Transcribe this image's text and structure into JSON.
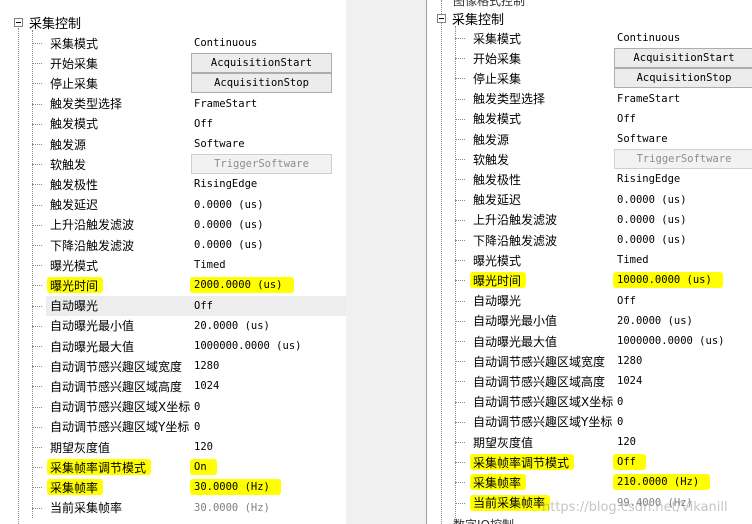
{
  "left": {
    "section_title": "采集控制",
    "rows": [
      {
        "name": "采集模式",
        "value": "Continuous",
        "kind": "text"
      },
      {
        "name": "开始采集",
        "value": "AcquisitionStart",
        "kind": "button"
      },
      {
        "name": "停止采集",
        "value": "AcquisitionStop",
        "kind": "button"
      },
      {
        "name": "触发类型选择",
        "value": "FrameStart",
        "kind": "text"
      },
      {
        "name": "触发模式",
        "value": "Off",
        "kind": "text"
      },
      {
        "name": "触发源",
        "value": "Software",
        "kind": "text"
      },
      {
        "name": "软触发",
        "value": "TriggerSoftware",
        "kind": "button-disabled"
      },
      {
        "name": "触发极性",
        "value": "RisingEdge",
        "kind": "text"
      },
      {
        "name": "触发延迟",
        "value": "0.0000 (us)",
        "kind": "text"
      },
      {
        "name": "上升沿触发滤波",
        "value": "0.0000 (us)",
        "kind": "text"
      },
      {
        "name": "下降沿触发滤波",
        "value": "0.0000 (us)",
        "kind": "text"
      },
      {
        "name": "曝光模式",
        "value": "Timed",
        "kind": "text"
      },
      {
        "name": "曝光时间",
        "value": "2000.0000 (us)",
        "kind": "text",
        "highlight_name": true,
        "highlight_value": true
      },
      {
        "name": "自动曝光",
        "value": "Off",
        "kind": "text",
        "selected": true
      },
      {
        "name": "自动曝光最小值",
        "value": "20.0000 (us)",
        "kind": "text"
      },
      {
        "name": "自动曝光最大值",
        "value": "1000000.0000 (us)",
        "kind": "text"
      },
      {
        "name": "自动调节感兴趣区域宽度",
        "value": "1280",
        "kind": "text"
      },
      {
        "name": "自动调节感兴趣区域高度",
        "value": "1024",
        "kind": "text"
      },
      {
        "name": "自动调节感兴趣区域X坐标",
        "value": "0",
        "kind": "text"
      },
      {
        "name": "自动调节感兴趣区域Y坐标",
        "value": "0",
        "kind": "text"
      },
      {
        "name": "期望灰度值",
        "value": "120",
        "kind": "text"
      },
      {
        "name": "采集帧率调节模式",
        "value": "On",
        "kind": "text",
        "highlight_name": true,
        "highlight_value": true
      },
      {
        "name": "采集帧率",
        "value": "30.0000 (Hz)",
        "kind": "text",
        "highlight_name": true,
        "highlight_value": true
      },
      {
        "name": "当前采集帧率",
        "value": "30.0000 (Hz)",
        "kind": "text",
        "disabled": true
      }
    ]
  },
  "right": {
    "top_fragment": "图像格式控制",
    "section_title": "采集控制",
    "bottom_fragment": "数字IO控制",
    "rows": [
      {
        "name": "采集模式",
        "value": "Continuous",
        "kind": "text"
      },
      {
        "name": "开始采集",
        "value": "AcquisitionStart",
        "kind": "button"
      },
      {
        "name": "停止采集",
        "value": "AcquisitionStop",
        "kind": "button"
      },
      {
        "name": "触发类型选择",
        "value": "FrameStart",
        "kind": "text"
      },
      {
        "name": "触发模式",
        "value": "Off",
        "kind": "text"
      },
      {
        "name": "触发源",
        "value": "Software",
        "kind": "text"
      },
      {
        "name": "软触发",
        "value": "TriggerSoftware",
        "kind": "button-disabled"
      },
      {
        "name": "触发极性",
        "value": "RisingEdge",
        "kind": "text"
      },
      {
        "name": "触发延迟",
        "value": "0.0000 (us)",
        "kind": "text"
      },
      {
        "name": "上升沿触发滤波",
        "value": "0.0000 (us)",
        "kind": "text"
      },
      {
        "name": "下降沿触发滤波",
        "value": "0.0000 (us)",
        "kind": "text"
      },
      {
        "name": "曝光模式",
        "value": "Timed",
        "kind": "text"
      },
      {
        "name": "曝光时间",
        "value": "10000.0000 (us)",
        "kind": "text",
        "highlight_name": true,
        "highlight_value": true
      },
      {
        "name": "自动曝光",
        "value": "Off",
        "kind": "text"
      },
      {
        "name": "自动曝光最小值",
        "value": "20.0000 (us)",
        "kind": "text"
      },
      {
        "name": "自动曝光最大值",
        "value": "1000000.0000 (us)",
        "kind": "text"
      },
      {
        "name": "自动调节感兴趣区域宽度",
        "value": "1280",
        "kind": "text"
      },
      {
        "name": "自动调节感兴趣区域高度",
        "value": "1024",
        "kind": "text"
      },
      {
        "name": "自动调节感兴趣区域X坐标",
        "value": "0",
        "kind": "text"
      },
      {
        "name": "自动调节感兴趣区域Y坐标",
        "value": "0",
        "kind": "text"
      },
      {
        "name": "期望灰度值",
        "value": "120",
        "kind": "text"
      },
      {
        "name": "采集帧率调节模式",
        "value": "Off",
        "kind": "text",
        "highlight_name": true,
        "highlight_value": true
      },
      {
        "name": "采集帧率",
        "value": "210.0000 (Hz)",
        "kind": "text",
        "highlight_name": true,
        "highlight_value": true
      },
      {
        "name": "当前采集帧率",
        "value": "99.4000 (Hz)",
        "kind": "text",
        "highlight_name": true,
        "disabled": true
      }
    ]
  },
  "watermark": "https://blog.csdn.net/Vikanill",
  "colors": {
    "highlight": "#ffff00",
    "selected_row": "#ededed",
    "button_bg": "#ececec"
  }
}
